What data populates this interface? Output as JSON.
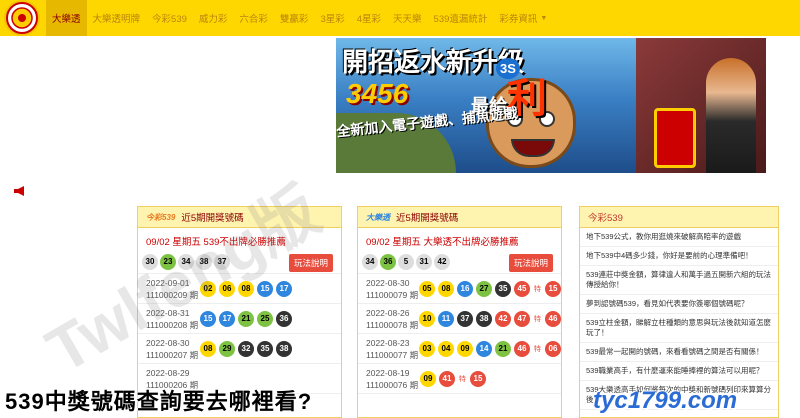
{
  "nav": {
    "items": [
      "大樂透",
      "大樂透明牌",
      "今彩539",
      "威力彩",
      "六合彩",
      "雙贏彩",
      "3星彩",
      "4星彩",
      "天天樂",
      "539遺漏統計",
      "彩券資訊"
    ],
    "active_index": 0
  },
  "banner": {
    "line1": "開招返水新升級",
    "line2": "3456",
    "line2b": "最給",
    "line2c": "利",
    "line3": "全新加入電子遊戲、捕魚遊戲",
    "badge": "3S"
  },
  "panel539": {
    "title": "近5期開獎號碼",
    "logo": "今彩539",
    "notice": "09/02 星期五 539不出牌必勝推薦",
    "rule_button": "玩法說明",
    "latest": [
      "30",
      "23",
      "34",
      "38",
      "37"
    ],
    "draws": [
      {
        "date": "2022-09-01",
        "id": "111000209 期",
        "balls": [
          "02",
          "06",
          "08",
          "15",
          "17"
        ]
      },
      {
        "date": "2022-08-31",
        "id": "111000208 期",
        "balls": [
          "15",
          "17",
          "21",
          "25",
          "36"
        ]
      },
      {
        "date": "2022-08-30",
        "id": "111000207 期",
        "balls": [
          "08",
          "29",
          "32",
          "35",
          "38"
        ]
      },
      {
        "date": "2022-08-29",
        "id": "111000206 期",
        "balls": [
          "",
          "",
          "",
          "",
          ""
        ]
      }
    ]
  },
  "panelLotto": {
    "title": "近5期開獎號碼",
    "logo": "大樂透",
    "notice": "09/02 星期五 大樂透不出牌必勝推薦",
    "rule_button": "玩法說明",
    "latest": [
      "34",
      "36",
      "5",
      "31",
      "42"
    ],
    "draws": [
      {
        "date": "2022-08-30",
        "id": "111000079 期",
        "balls": [
          "05",
          "08",
          "16",
          "27",
          "35",
          "45"
        ],
        "special": "15"
      },
      {
        "date": "2022-08-26",
        "id": "111000078 期",
        "balls": [
          "10",
          "11",
          "37",
          "38",
          "42",
          "47"
        ],
        "special": "46"
      },
      {
        "date": "2022-08-23",
        "id": "111000077 期",
        "balls": [
          "03",
          "04",
          "09",
          "14",
          "21",
          "46"
        ],
        "special": "06"
      },
      {
        "date": "2022-08-19",
        "id": "111000076 期",
        "balls": [
          "09",
          "",
          "",
          "",
          "41",
          ""
        ],
        "special": "15"
      }
    ]
  },
  "news": {
    "title": "今彩539",
    "items": [
      "地下539公式，教你用逛燒來破解高賠率的遊戲",
      "地下539中4碼多少錢，你好是要前的心理準備吧！",
      "539連莊中獎金額，算律違人和萬手過五開新六組的玩法傳授給你！",
      "夢到認號碼539，看見如代表要你簽哪個號碼呢？",
      "539立柱金額，睇解立柱種類的意思與玩法後就知道怎麼玩了！",
      "539最常一起開的號碼，來看看號碼之間是否有關係！",
      "539職業高手，有什麼運來能睡捧裡的算法可以用呢？",
      "539大樂透高手如何將每次的中獎和新號碼列印來算算分後"
    ]
  },
  "watermark": "Twlfeng版",
  "caption": "539中獎號碼查詢要去哪裡看?",
  "url": "tyc1799.com"
}
